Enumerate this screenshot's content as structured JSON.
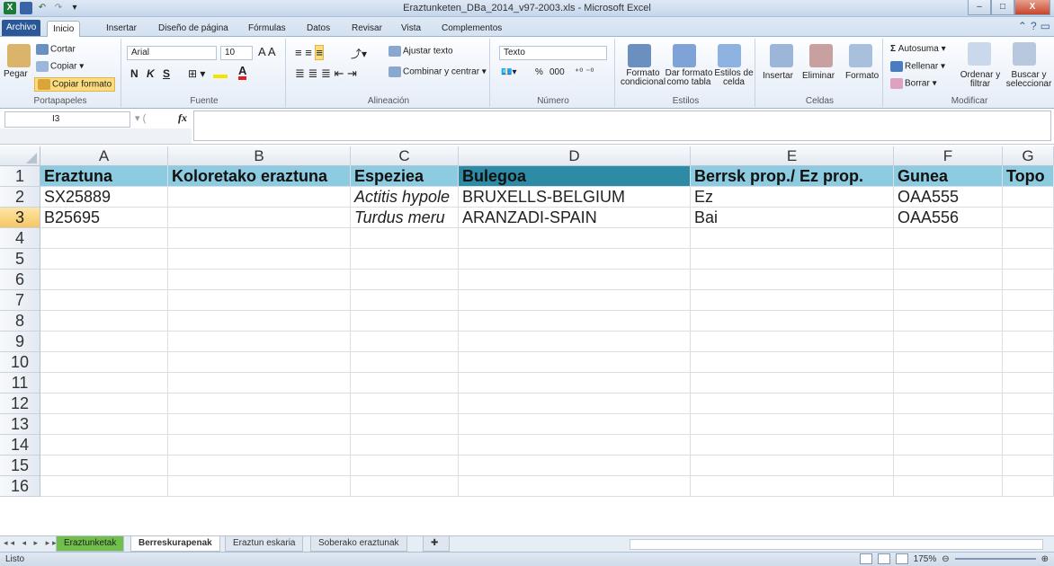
{
  "window": {
    "title": "Eraztunketen_DBa_2014_v97-2003.xls - Microsoft Excel",
    "minimize": "–",
    "maximize": "□",
    "close": "X"
  },
  "tabs": [
    "Archivo",
    "Inicio",
    "Insertar",
    "Diseño de página",
    "Fórmulas",
    "Datos",
    "Revisar",
    "Vista",
    "Complementos"
  ],
  "ribbon": {
    "clipboard": {
      "paste": "Pegar",
      "cut": "Cortar",
      "copy": "Copiar",
      "format_painter": "Copiar formato",
      "label": "Portapapeles"
    },
    "font": {
      "name": "Arial",
      "size": "10",
      "bold": "N",
      "italic": "K",
      "underline": "S",
      "label": "Fuente"
    },
    "alignment": {
      "wrap": "Ajustar texto",
      "merge": "Combinar y centrar",
      "label": "Alineación"
    },
    "number": {
      "format": "Texto",
      "percent": "%",
      "thousands": "000",
      "label": "Número"
    },
    "styles": {
      "conditional": "Formato condicional",
      "as_table": "Dar formato como tabla",
      "cell_styles": "Estilos de celda",
      "label": "Estilos"
    },
    "cells": {
      "insert": "Insertar",
      "delete": "Eliminar",
      "format": "Formato",
      "label": "Celdas"
    },
    "editing": {
      "autosum": "Autosuma",
      "fill": "Rellenar",
      "clear": "Borrar",
      "sort": "Ordenar y filtrar",
      "find": "Buscar y seleccionar",
      "label": "Modificar"
    }
  },
  "formula": {
    "name_box": "I3",
    "fx": "fx",
    "value": ""
  },
  "columns": [
    "A",
    "B",
    "C",
    "D",
    "E",
    "F",
    "G"
  ],
  "rows": [
    "1",
    "2",
    "3",
    "4",
    "5",
    "6",
    "7",
    "8",
    "9",
    "10",
    "11",
    "12",
    "13",
    "14",
    "15",
    "16"
  ],
  "header_row": [
    "Eraztuna",
    "Koloretako eraztuna",
    "Espeziea",
    "Bulegoa",
    "Berrsk prop./ Ez prop.",
    "Gunea",
    "Topo"
  ],
  "data_rows": [
    [
      "SX25889",
      "",
      "Actitis hypole",
      "BRUXELLS-BELGIUM",
      "Ez",
      "OAA555",
      ""
    ],
    [
      "B25695",
      "",
      "Turdus meru",
      "ARANZADI-SPAIN",
      "Bai",
      "OAA556",
      ""
    ]
  ],
  "sheets": [
    "Eraztunketak",
    "Berreskurapenak",
    "Eraztun eskaria",
    "Soberako eraztunak"
  ],
  "status": {
    "ready": "Listo",
    "zoom": "175%"
  }
}
